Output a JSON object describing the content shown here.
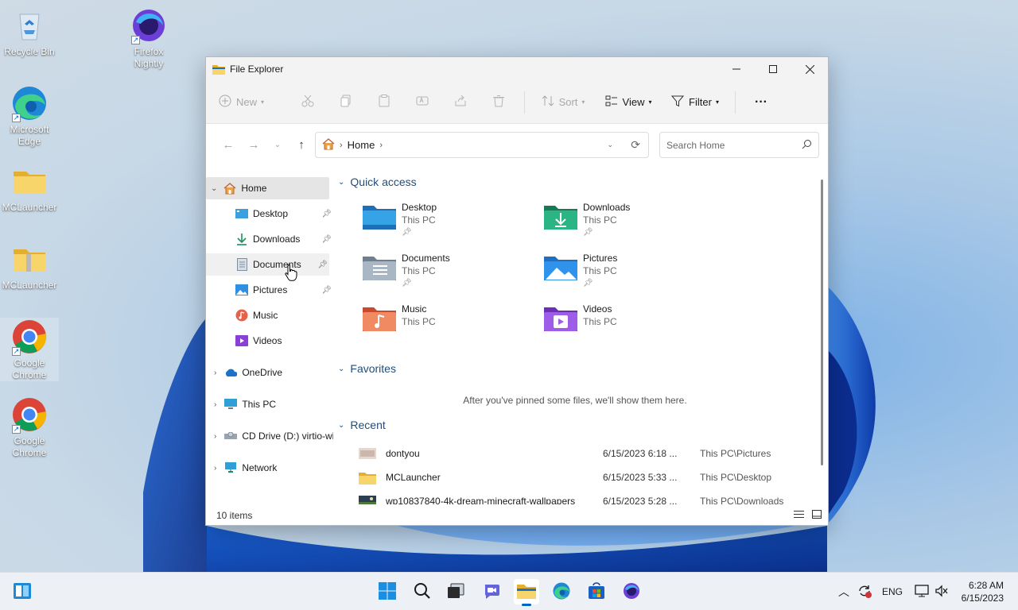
{
  "desktop": {
    "icons": [
      {
        "label": "Recycle Bin"
      },
      {
        "label": "Firefox Nightly"
      },
      {
        "label": "Microsoft Edge"
      },
      {
        "label": "MCLauncher"
      },
      {
        "label": "MCLauncher"
      },
      {
        "label": "Google Chrome"
      },
      {
        "label": "Google Chrome"
      }
    ]
  },
  "window": {
    "title": "File Explorer",
    "toolbar": {
      "new_label": "New",
      "sort_label": "Sort",
      "view_label": "View",
      "filter_label": "Filter",
      "more_label": "···"
    },
    "address": {
      "crumb": "Home",
      "search_placeholder": "Search Home"
    },
    "nav": {
      "home": "Home",
      "desktop": "Desktop",
      "downloads": "Downloads",
      "documents": "Documents",
      "pictures": "Pictures",
      "music": "Music",
      "videos": "Videos",
      "onedrive": "OneDrive",
      "thispc": "This PC",
      "cddrive": "CD Drive (D:) virtio-win",
      "network": "Network"
    },
    "quick_access": {
      "heading": "Quick access",
      "items": [
        {
          "name": "Desktop",
          "location": "This PC"
        },
        {
          "name": "Downloads",
          "location": "This PC"
        },
        {
          "name": "Documents",
          "location": "This PC"
        },
        {
          "name": "Pictures",
          "location": "This PC"
        },
        {
          "name": "Music",
          "location": "This PC"
        },
        {
          "name": "Videos",
          "location": "This PC"
        }
      ]
    },
    "favorites": {
      "heading": "Favorites",
      "message": "After you've pinned some files, we'll show them here."
    },
    "recent": {
      "heading": "Recent",
      "rows": [
        {
          "name": "dontyou",
          "date": "6/15/2023 6:18 ...",
          "location": "This PC\\Pictures"
        },
        {
          "name": "MCLauncher",
          "date": "6/15/2023 5:33 ...",
          "location": "This PC\\Desktop"
        },
        {
          "name": "wp10837840-4k-dream-minecraft-wallpapers",
          "date": "6/15/2023 5:28 ...",
          "location": "This PC\\Downloads"
        }
      ]
    },
    "status": {
      "item_count": "10 items"
    }
  },
  "taskbar": {
    "language": "ENG",
    "time": "6:28 AM",
    "date": "6/15/2023"
  },
  "colors": {
    "accent": "#0067c0",
    "folder_yellow": "#f5c84c",
    "section_heading": "#1f4e79"
  }
}
